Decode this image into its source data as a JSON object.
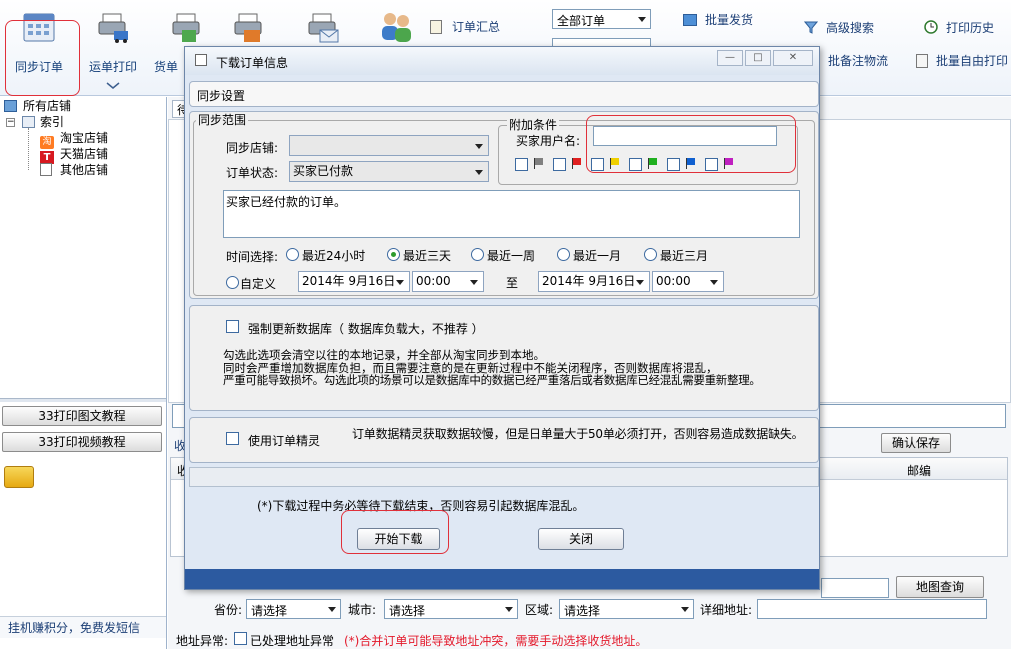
{
  "toolbar": {
    "sync_orders": "同步订单",
    "waybill_print": "运单打印",
    "goods_partial": "货单",
    "order_summary": "订单汇总",
    "order_filter": "全部订单",
    "batch_ship": "批量发货",
    "advanced_search": "高级搜索",
    "print_history": "打印历史",
    "batch_note_logistics": "批备注物流",
    "batch_free_print": "批量自由打印"
  },
  "left": {
    "all_shops": "所有店铺",
    "index": "索引",
    "shops": [
      "淘宝店铺",
      "天猫店铺",
      "其他店铺"
    ],
    "tutorial_text": "33打印图文教程",
    "tutorial_video": "33打印视频教程",
    "earn_points": "挂机赚积分，免费发短信"
  },
  "main": {
    "tab_partial": "待",
    "receive_partial": "收",
    "col_partial": "收",
    "confirm_save": "确认保存",
    "postcode_header": "邮编",
    "province_label": "省份:",
    "city_label": "城市:",
    "district_label": "区域:",
    "detail_addr_label": "详细地址:",
    "select_prompt": "请选择",
    "map_query": "地图查询",
    "addr_abnormal_label": "地址异常:",
    "addr_handled": "已处理地址异常",
    "merge_warning": "(*)合并订单可能导致地址冲突，需要手动选择收货地址。"
  },
  "dialog": {
    "title": "下载订单信息",
    "sync_settings": "同步设置",
    "sync_range": "同步范围",
    "sync_shop_label": "同步店铺:",
    "order_status_label": "订单状态:",
    "order_status_value": "买家已付款",
    "status_desc": "买家已经付款的订单。",
    "extra_conditions": "附加条件",
    "buyer_name_label": "买家用户名:",
    "flag_colors": [
      "#808080",
      "#e02020",
      "#f0d000",
      "#20b020",
      "#1060d0",
      "#c020c0"
    ],
    "time_select_label": "时间选择:",
    "time_options": [
      "最近24小时",
      "最近三天",
      "最近一周",
      "最近一月",
      "最近三月"
    ],
    "custom": "自定义",
    "date_from": "2014年  9月16日",
    "time_from": "00:00",
    "to_label": "至",
    "date_to": "2014年  9月16日",
    "time_to": "00:00",
    "force_update": "强制更新数据库（ 数据库负载大，不推荐 ）",
    "force_desc": [
      "勾选此选项会清空以往的本地记录，并全部从淘宝同步到本地。",
      "同时会严重增加数据库负担，而且需要注意的是在更新过程中不能关闭程序，否则数据库将混乱，",
      "严重可能导致损坏。勾选此项的场景可以是数据库中的数据已经严重落后或者数据库已经混乱需要重新整理。"
    ],
    "use_elf": "使用订单精灵",
    "elf_desc": "订单数据精灵获取数据较慢，但是日单量大于50单必须打开，否则容易造成数据缺失。",
    "download_warning": "(*)下载过程中务必等待下载结束，否则容易引起数据库混乱。",
    "start_download": "开始下载",
    "close": "关闭"
  }
}
